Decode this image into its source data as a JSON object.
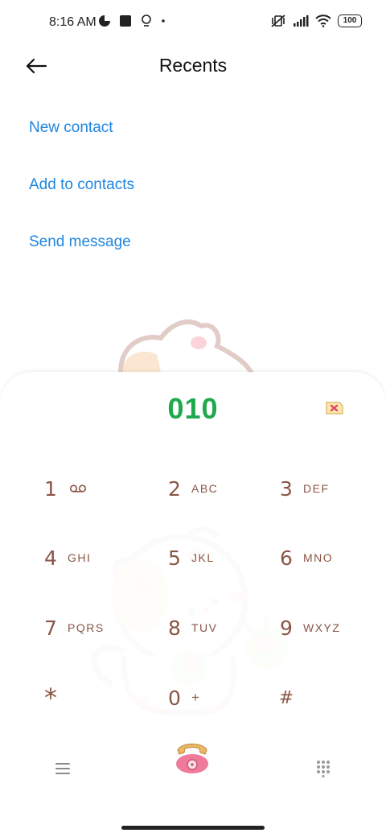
{
  "status_bar": {
    "time": "8:16 AM",
    "battery": "100"
  },
  "header": {
    "title": "Recents",
    "back_icon": "arrow-left-icon"
  },
  "actions": [
    {
      "label": "New contact"
    },
    {
      "label": "Add to contacts"
    },
    {
      "label": "Send message"
    }
  ],
  "dialer": {
    "entered_number": "010",
    "keys": [
      {
        "digit": "1",
        "letters": ""
      },
      {
        "digit": "2",
        "letters": "ABC"
      },
      {
        "digit": "3",
        "letters": "DEF"
      },
      {
        "digit": "4",
        "letters": "GHI"
      },
      {
        "digit": "5",
        "letters": "JKL"
      },
      {
        "digit": "6",
        "letters": "MNO"
      },
      {
        "digit": "7",
        "letters": "PQRS"
      },
      {
        "digit": "8",
        "letters": "TUV"
      },
      {
        "digit": "9",
        "letters": "WXYZ"
      },
      {
        "digit": "*",
        "letters": ""
      },
      {
        "digit": "0",
        "letters": "+"
      },
      {
        "digit": "#",
        "letters": ""
      }
    ]
  },
  "colors": {
    "accent_blue": "#1e86e0",
    "number_green": "#1eaa4c",
    "key_brown": "#8a5646"
  }
}
